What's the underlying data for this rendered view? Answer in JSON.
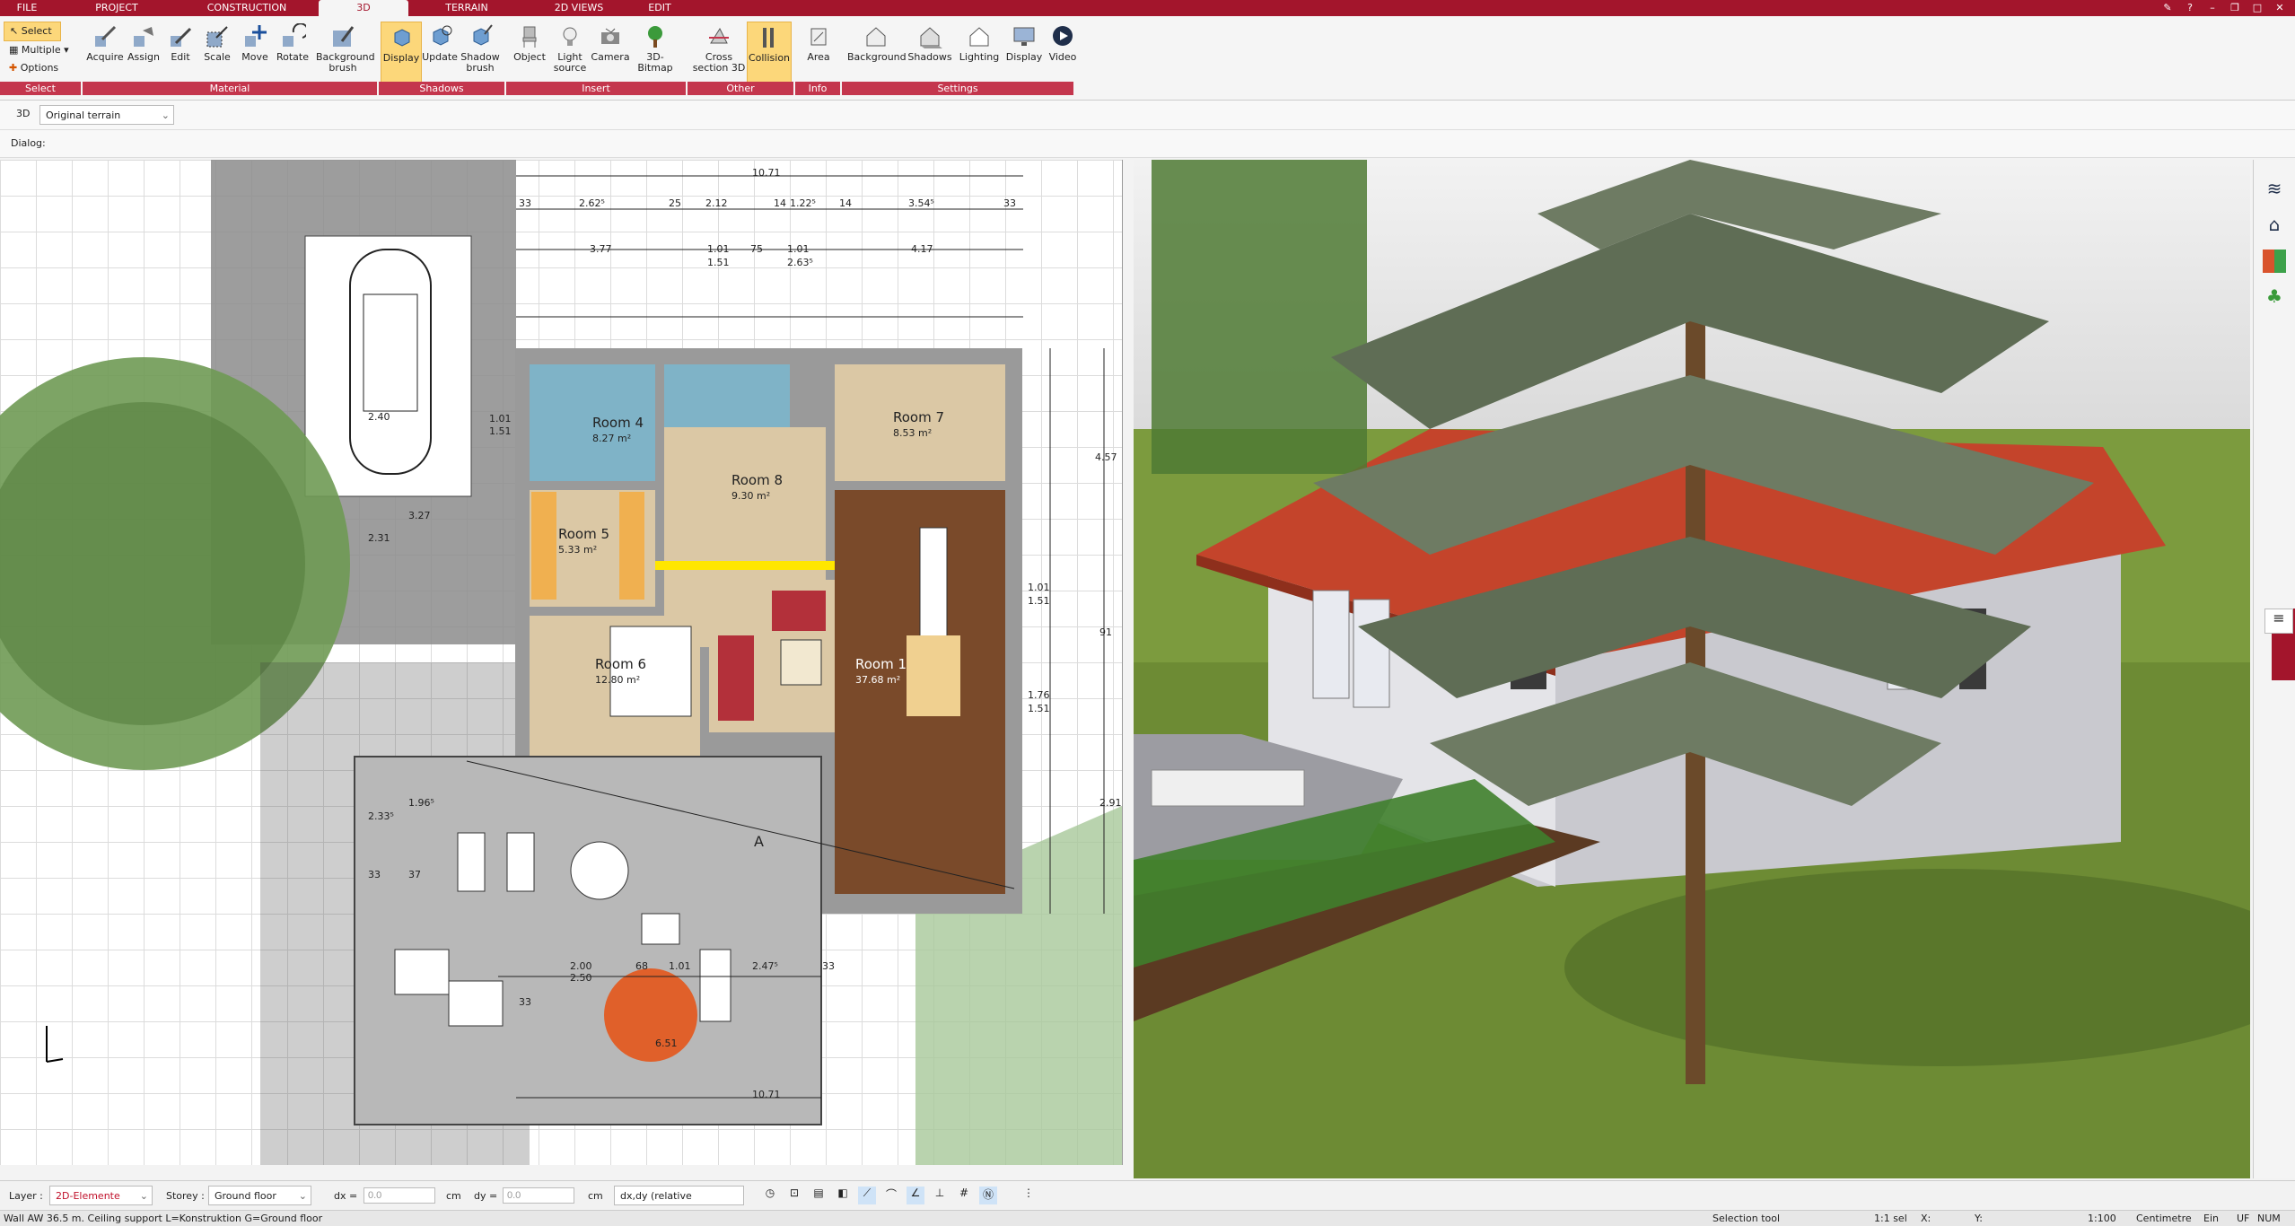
{
  "tabs": [
    "FILE",
    "PROJECT",
    "CONSTRUCTION",
    "3D",
    "TERRAIN",
    "2D VIEWS",
    "EDIT"
  ],
  "active_tab": "3D",
  "ribbon": {
    "select_group": {
      "select": "Select",
      "multiple": "Multiple",
      "options": "Options",
      "group": "Select"
    },
    "material": {
      "acquire": "Acquire",
      "assign": "Assign",
      "edit": "Edit",
      "scale": "Scale",
      "move": "Move",
      "rotate": "Rotate",
      "background_brush": "Background brush",
      "group": "Material"
    },
    "shadows": {
      "display": "Display",
      "update": "Update",
      "shadow_brush": "Shadow brush",
      "group": "Shadows"
    },
    "insert": {
      "object": "Object",
      "light_source": "Light source",
      "camera": "Camera",
      "bitmap3d": "3D-Bitmap",
      "group": "Insert"
    },
    "other": {
      "cross_section": "Cross section 3D",
      "collision": "Collision",
      "group": "Other"
    },
    "info": {
      "area": "Area",
      "group": "Info"
    },
    "settings": {
      "background": "Background",
      "shadows": "Shadows",
      "lighting": "Lighting",
      "display": "Display",
      "video": "Video",
      "group": "Settings"
    }
  },
  "view_row": {
    "mode": "3D",
    "terrain": "Original terrain"
  },
  "dialog_label": "Dialog:",
  "plan": {
    "rooms": [
      {
        "name": "Room 4",
        "area": "8.27 m²"
      },
      {
        "name": "Room 7",
        "area": "8.53 m²"
      },
      {
        "name": "Room 8",
        "area": "9.30 m²"
      },
      {
        "name": "Room 5",
        "area": "5.33 m²"
      },
      {
        "name": "Room 6",
        "area": "12.80 m²"
      },
      {
        "name": "Room 1",
        "area": "37.68 m²"
      }
    ],
    "dims": {
      "top_total": "10.71",
      "bottom_total": "10.71",
      "top_segments": [
        "33",
        "2.62⁵",
        "25",
        "2.12",
        "14",
        "1.22⁵",
        "14",
        "3.54⁵",
        "33"
      ],
      "row2": [
        "3.77",
        "1.01",
        "1.51",
        "75",
        "1.01",
        "2.63⁵",
        "4.17"
      ],
      "right_side": [
        "4.57",
        "1.01",
        "1.51",
        "91",
        "1.76",
        "1.51",
        "2.91"
      ],
      "terrace": [
        "2.00",
        "2.50",
        "68",
        "1.01",
        "2.47⁵",
        "33",
        "33"
      ],
      "left": [
        "2.33⁵",
        "1.96⁵",
        "37",
        "33",
        "2.31",
        "3.27",
        "2.40",
        "1.01",
        "1.51"
      ],
      "table_label": "6.51",
      "section_marker": "A"
    }
  },
  "bottom": {
    "layer_label": "Layer :",
    "layer_value": "2D-Elemente",
    "storey_label": "Storey :",
    "storey_value": "Ground floor",
    "dx_label": "dx =",
    "dx_value": "0.0",
    "dy_label": "dy =",
    "dy_value": "0.0",
    "unit": "cm",
    "coord_mode": "dx,dy (relative cartesian)"
  },
  "status": {
    "message": "Wall AW 36.5 m. Ceiling support L=Konstruktion G=Ground floor",
    "selection_count": "1:1 sel",
    "tool": "Selection tool",
    "x_label": "X:",
    "y_label": "Y:",
    "scale": "1:100",
    "unit": "Centimetre",
    "ein": "Ein",
    "uf": "UF",
    "num": "NUM"
  },
  "colors": {
    "brand": "#a3152c",
    "group_bar": "#c4364d",
    "active_button": "#fcd77a",
    "wall": "#9a9a9a",
    "highlight": "#ffe600"
  }
}
